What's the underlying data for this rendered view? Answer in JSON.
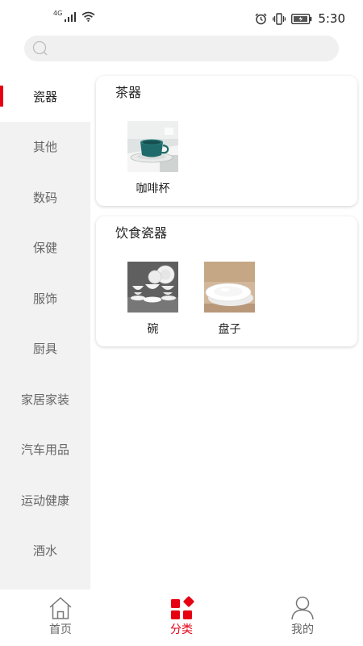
{
  "status_bar": {
    "network": "4G",
    "time": "5:30"
  },
  "search": {
    "placeholder": ""
  },
  "sidebar": {
    "items": [
      {
        "label": "瓷器",
        "active": true
      },
      {
        "label": "其他",
        "active": false
      },
      {
        "label": "数码",
        "active": false
      },
      {
        "label": "保健",
        "active": false
      },
      {
        "label": "服饰",
        "active": false
      },
      {
        "label": "厨具",
        "active": false
      },
      {
        "label": "家居家装",
        "active": false
      },
      {
        "label": "汽车用品",
        "active": false
      },
      {
        "label": "运动健康",
        "active": false
      },
      {
        "label": "酒水",
        "active": false
      }
    ]
  },
  "sections": [
    {
      "title": "茶器",
      "items": [
        {
          "label": "咖啡杯",
          "icon": "coffee-cup-photo"
        }
      ]
    },
    {
      "title": "饮食瓷器",
      "items": [
        {
          "label": "碗",
          "icon": "bowl-set-photo"
        },
        {
          "label": "盘子",
          "icon": "plates-photo"
        }
      ]
    }
  ],
  "tabbar": {
    "items": [
      {
        "label": "首页",
        "icon": "home-icon",
        "active": false
      },
      {
        "label": "分类",
        "icon": "category-icon",
        "active": true
      },
      {
        "label": "我的",
        "icon": "profile-icon",
        "active": false
      }
    ]
  },
  "colors": {
    "accent": "#e60012",
    "sidebar_bg": "#f2f2f2",
    "search_bg": "#f0f0f0"
  }
}
